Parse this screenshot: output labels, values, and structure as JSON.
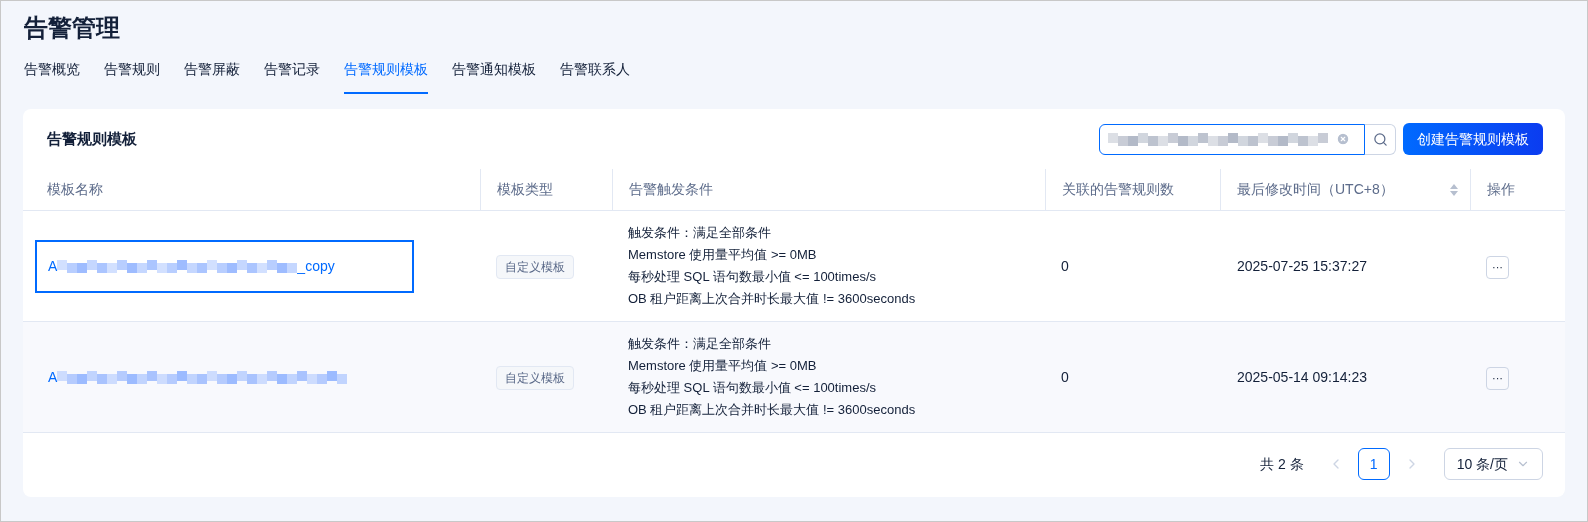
{
  "page_title": "告警管理",
  "tabs": [
    {
      "label": "告警概览",
      "selected": false
    },
    {
      "label": "告警规则",
      "selected": false
    },
    {
      "label": "告警屏蔽",
      "selected": false
    },
    {
      "label": "告警记录",
      "selected": false
    },
    {
      "label": "告警规则模板",
      "selected": true
    },
    {
      "label": "告警通知模板",
      "selected": false
    },
    {
      "label": "告警联系人",
      "selected": false
    }
  ],
  "card": {
    "title": "告警规则模板",
    "search": {
      "redacted": true
    },
    "create_button": "创建告警规则模板"
  },
  "table": {
    "columns": [
      {
        "label": "模板名称",
        "sortable": false
      },
      {
        "label": "模板类型",
        "sortable": false
      },
      {
        "label": "告警触发条件",
        "sortable": false
      },
      {
        "label": "关联的告警规则数",
        "sortable": false
      },
      {
        "label": "最后修改时间（UTC+8）",
        "sortable": true
      },
      {
        "label": "操作",
        "sortable": false
      }
    ],
    "rows": [
      {
        "name_start": "A",
        "name_end": "_copy",
        "focused": true,
        "type": "自定义模板",
        "conditions": [
          "触发条件：满足全部条件",
          "Memstore 使用量平均值 >= 0MB",
          "每秒处理 SQL 语句数最小值 <= 100times/s",
          "OB 租户距离上次合并时长最大值 != 3600seconds"
        ],
        "rule_count": "0",
        "modified": "2025-07-25 15:37:27",
        "action": "···"
      },
      {
        "name_start": "A",
        "focused": false,
        "type": "自定义模板",
        "conditions": [
          "触发条件：满足全部条件",
          "Memstore 使用量平均值 >= 0MB",
          "每秒处理 SQL 语句数最小值 <= 100times/s",
          "OB 租户距离上次合并时长最大值 != 3600seconds"
        ],
        "rule_count": "0",
        "modified": "2025-05-14 09:14:23",
        "action": "···"
      }
    ]
  },
  "pagination": {
    "total": "共 2 条",
    "pages": [
      {
        "label": "1",
        "selected": true
      }
    ],
    "page_size": "10 条/页"
  }
}
